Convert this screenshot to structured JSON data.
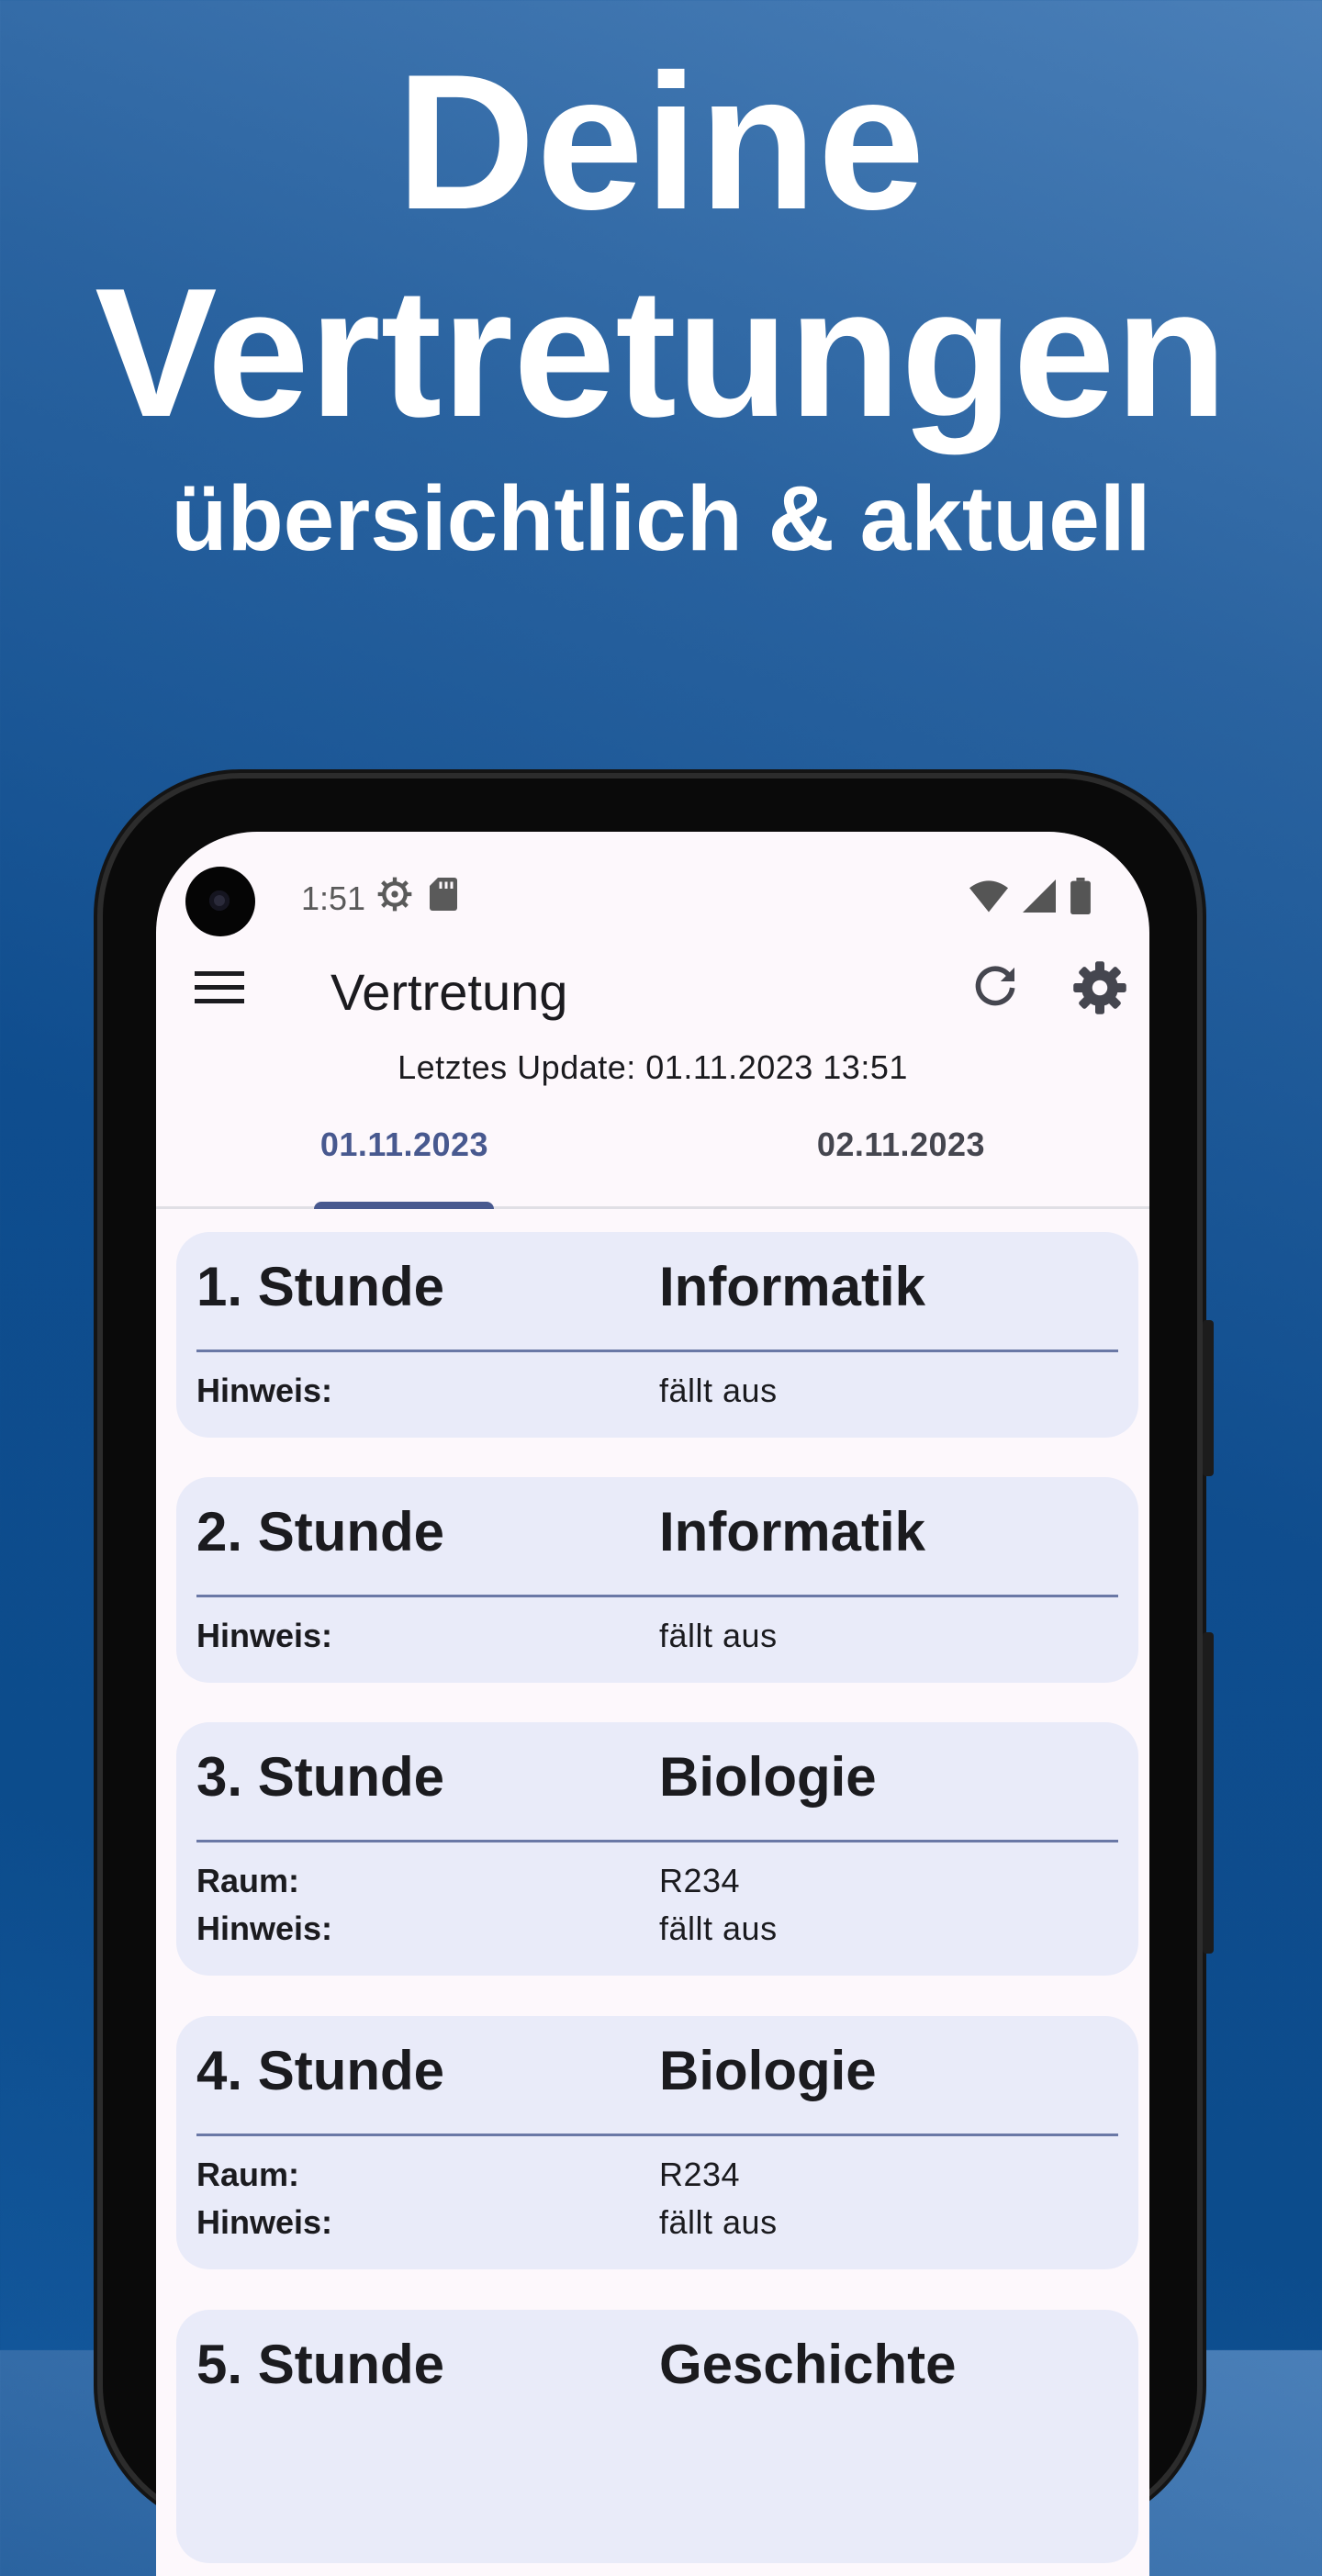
{
  "promo": {
    "line1": "Deine",
    "line2": "Vertretungen",
    "line3": "übersichtlich & aktuell"
  },
  "status_bar": {
    "time": "1:51",
    "icons_left": [
      "settings-gear-icon",
      "sd-card-icon"
    ],
    "icons_right": [
      "wifi-icon",
      "signal-icon",
      "battery-icon"
    ]
  },
  "app_bar": {
    "title": "Vertretung",
    "menu_icon": "menu-icon",
    "refresh_icon": "refresh-icon",
    "settings_icon": "gear-icon"
  },
  "last_update": "Letztes Update: 01.11.2023 13:51",
  "tabs": [
    {
      "label": "01.11.2023",
      "selected": true
    },
    {
      "label": "02.11.2023",
      "selected": false
    }
  ],
  "entries": [
    {
      "period": "1. Stunde",
      "subject": "Informatik",
      "rows": [
        {
          "key": "Hinweis:",
          "value": "fällt aus"
        }
      ]
    },
    {
      "period": "2. Stunde",
      "subject": "Informatik",
      "rows": [
        {
          "key": "Hinweis:",
          "value": "fällt aus"
        }
      ]
    },
    {
      "period": "3. Stunde",
      "subject": "Biologie",
      "rows": [
        {
          "key": "Raum:",
          "value": "R234"
        },
        {
          "key": "Hinweis:",
          "value": "fällt aus"
        }
      ]
    },
    {
      "period": "4. Stunde",
      "subject": "Biologie",
      "rows": [
        {
          "key": "Raum:",
          "value": "R234"
        },
        {
          "key": "Hinweis:",
          "value": "fällt aus"
        }
      ]
    },
    {
      "period": "5. Stunde",
      "subject": "Geschichte",
      "rows": []
    }
  ],
  "colors": {
    "primary": "#48598f",
    "card_background": "#e9ebf9",
    "screen_background": "#fdf8fc",
    "promo_background": "#0f4d8e"
  }
}
